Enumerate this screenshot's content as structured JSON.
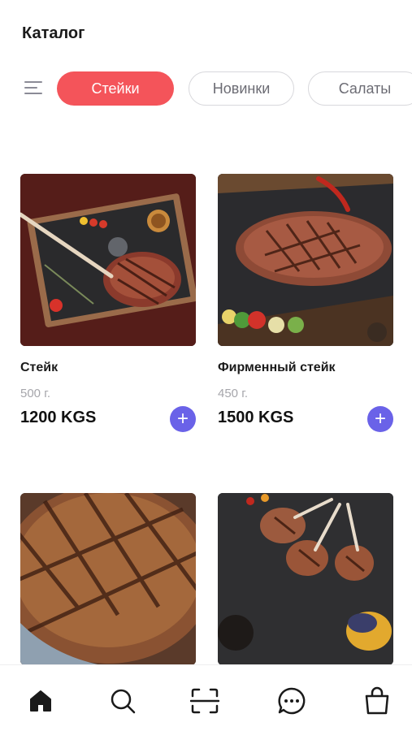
{
  "header": {
    "title": "Каталог"
  },
  "filters": {
    "icon": "filter-lines-icon",
    "chips": [
      {
        "label": "Стейки",
        "active": true
      },
      {
        "label": "Новинки",
        "active": false
      },
      {
        "label": "Салаты",
        "active": false
      }
    ],
    "accent_color": "#f4545a"
  },
  "products": [
    {
      "name": "Стейк",
      "weight": "500 г.",
      "price": "1200 KGS"
    },
    {
      "name": "Фирменный стейк",
      "weight": "450 г.",
      "price": "1500 KGS"
    },
    {
      "name": "",
      "weight": "",
      "price": ""
    },
    {
      "name": "",
      "weight": "",
      "price": ""
    }
  ],
  "add_button": {
    "icon": "plus-icon",
    "glyph": "+",
    "color": "#6a62e8"
  },
  "tabbar": {
    "items": [
      {
        "icon": "home-icon",
        "active": true
      },
      {
        "icon": "search-icon",
        "active": false
      },
      {
        "icon": "scan-icon",
        "active": false
      },
      {
        "icon": "chat-icon",
        "active": false
      },
      {
        "icon": "shopping-bag-icon",
        "active": false
      }
    ]
  }
}
